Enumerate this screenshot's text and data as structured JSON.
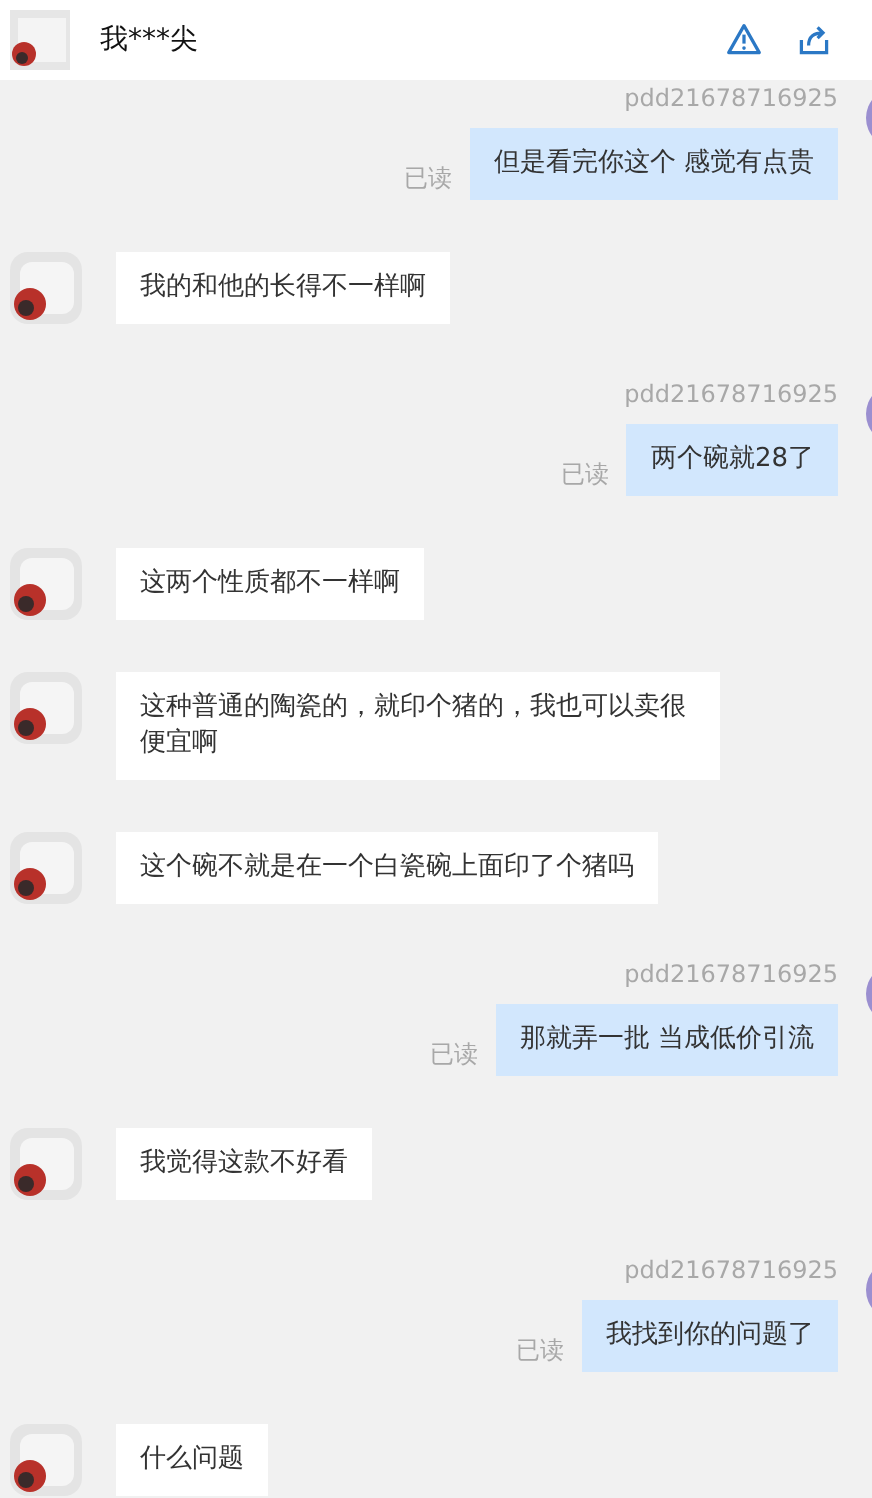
{
  "header": {
    "title": "我***尖"
  },
  "messages": [
    {
      "kind": "sent",
      "sender": "pdd21678716925",
      "status": "已读",
      "text": "但是看完你这个 感觉有点贵"
    },
    {
      "kind": "received",
      "text": "我的和他的长得不一样啊"
    },
    {
      "kind": "sent",
      "sender": "pdd21678716925",
      "status": "已读",
      "text": "两个碗就28了"
    },
    {
      "kind": "received",
      "text": "这两个性质都不一样啊"
    },
    {
      "kind": "received",
      "text": "这种普通的陶瓷的，就印个猪的，我也可以卖很便宜啊"
    },
    {
      "kind": "received",
      "text": "这个碗不就是在一个白瓷碗上面印了个猪吗"
    },
    {
      "kind": "sent",
      "sender": "pdd21678716925",
      "status": "已读",
      "text": "那就弄一批 当成低价引流"
    },
    {
      "kind": "received",
      "text": "我觉得这款不好看"
    },
    {
      "kind": "sent",
      "sender": "pdd21678716925",
      "status": "已读",
      "text": "我找到你的问题了"
    },
    {
      "kind": "received",
      "text": "什么问题"
    }
  ]
}
